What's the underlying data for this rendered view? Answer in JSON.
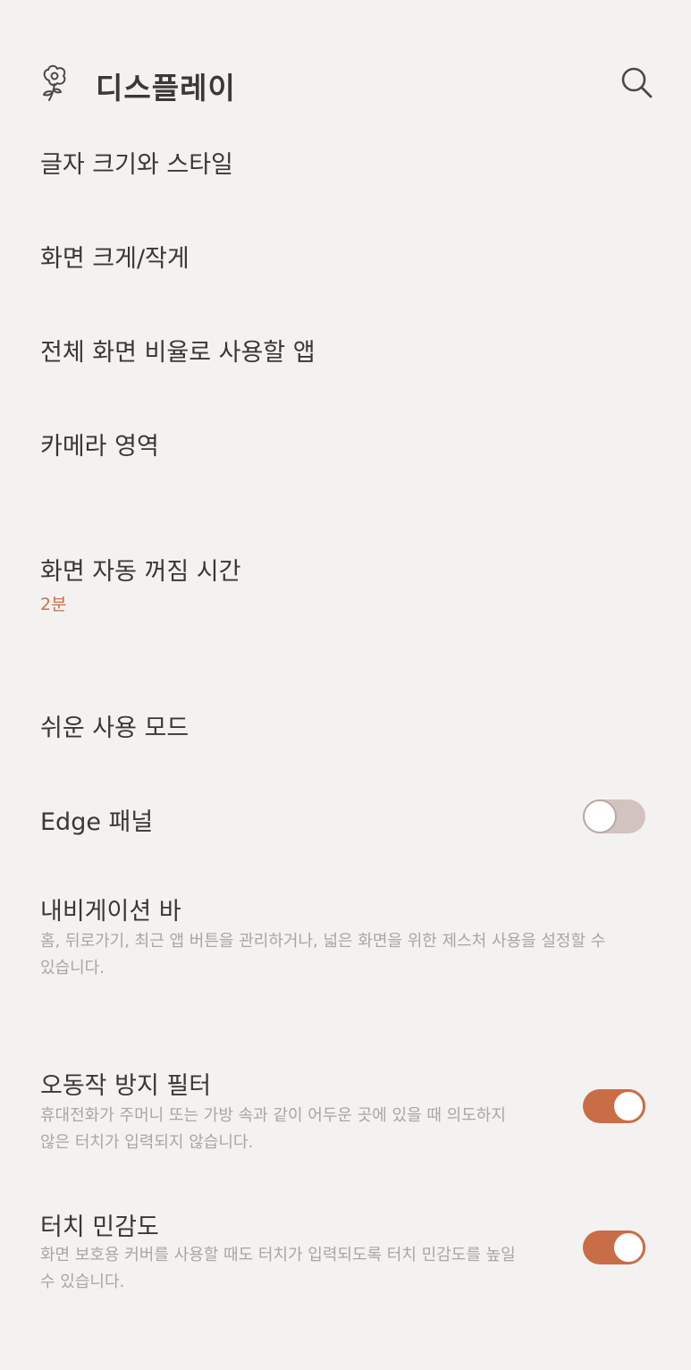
{
  "header": {
    "title": "디스플레이",
    "logo_icon": "flower-icon",
    "search_icon": "search-icon"
  },
  "colors": {
    "accent": "#c96d47",
    "value_text": "#c8714a",
    "background": "#f3f2f1",
    "toggle_off": "#d1c3bf"
  },
  "items": {
    "font_size": {
      "label": "글자 크기와 스타일"
    },
    "screen_zoom": {
      "label": "화면 크게/작게"
    },
    "fullscreen_apps": {
      "label": "전체 화면 비율로 사용할 앱"
    },
    "camera_cutout": {
      "label": "카메라 영역"
    },
    "screen_timeout": {
      "label": "화면 자동 꺼짐 시간",
      "value": "2분"
    },
    "easy_mode": {
      "label": "쉬운 사용 모드"
    },
    "edge_panels": {
      "label": "Edge 패널",
      "enabled": false
    },
    "navigation_bar": {
      "label": "내비게이션 바",
      "description_1": "홈, 뒤로가기, 최근 앱 버튼을 관리하거나, 넓은 화면을 위한 제스처 사용을 설정할 수",
      "description_2": "있습니다."
    },
    "accidental_touch": {
      "label": "오동작 방지 필터",
      "description_1": "휴대전화가 주머니 또는 가방 속과 같이 어두운 곳에 있을 때 의도하지",
      "description_2": "않은 터치가 입력되지 않습니다.",
      "enabled": true
    },
    "touch_sensitivity": {
      "label": "터치 민감도",
      "description_1": "화면 보호용 커버를 사용할 때도 터치가 입력되도록 터치 민감도를 높일",
      "description_2": "수 있습니다.",
      "enabled": true
    }
  }
}
